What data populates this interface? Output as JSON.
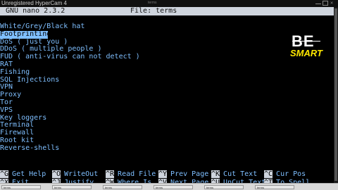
{
  "watermark": "Unregistered HyperCam 4",
  "window_title": "terms",
  "nano": {
    "version": "GNU nano 2.3.2",
    "file": "File: terms"
  },
  "lines": [
    "White/Grey/Black hat",
    "Footprinting",
    "DoS ( just you )",
    "DDoS ( multiple people )",
    "FUD ( anti-virus can not detect )",
    "RAT",
    "Fishing",
    "SQL Injections",
    "VPN",
    "Proxy",
    "Tor",
    "VPS",
    "Key loggers",
    "Terminal",
    "Firewall",
    "Root kit",
    "Reverse-shells"
  ],
  "logo": {
    "top": "BE",
    "bottom": "SMART"
  },
  "shortcuts": [
    {
      "key": "^G",
      "label": "Get Help"
    },
    {
      "key": "^O",
      "label": "WriteOut"
    },
    {
      "key": "^R",
      "label": "Read File"
    },
    {
      "key": "^Y",
      "label": "Prev Page"
    },
    {
      "key": "^K",
      "label": "Cut Text"
    },
    {
      "key": "^C",
      "label": "Cur Pos"
    },
    {
      "key": "^X",
      "label": "Exit"
    },
    {
      "key": "^J",
      "label": "Justify"
    },
    {
      "key": "^W",
      "label": "Where Is"
    },
    {
      "key": "^V",
      "label": "Next Page"
    },
    {
      "key": "^U",
      "label": "UnCut Text"
    },
    {
      "key": "^T",
      "label": "To Spell"
    }
  ],
  "taskbar": [
    "terms",
    "terms",
    "terms",
    "terms",
    "terms",
    "terms"
  ],
  "colors": {
    "text": "#7fbfff",
    "header_bg": "#cfd5de",
    "bg": "#000000",
    "logo_accent": "#ffe800"
  }
}
